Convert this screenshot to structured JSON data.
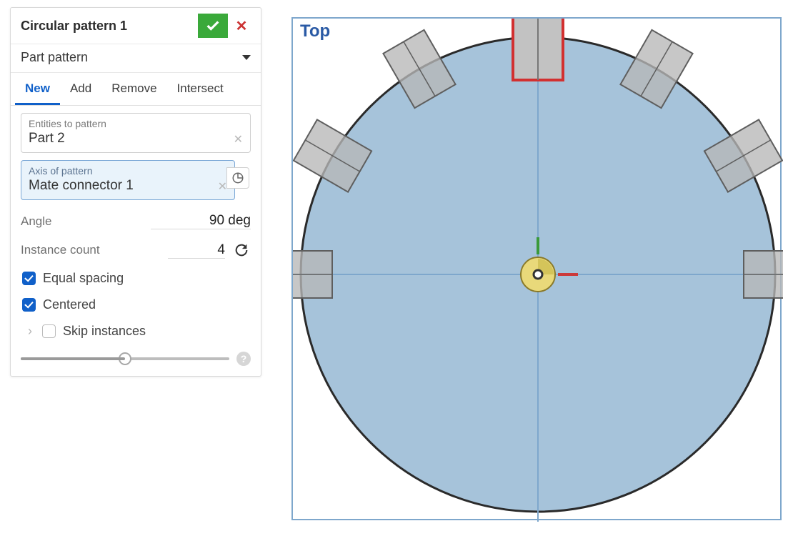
{
  "panel": {
    "title": "Circular pattern 1",
    "type_label": "Part pattern",
    "tabs": [
      "New",
      "Add",
      "Remove",
      "Intersect"
    ],
    "active_tab": 0,
    "entities_field": {
      "label": "Entities to pattern",
      "value": "Part 2"
    },
    "axis_field": {
      "label": "Axis of pattern",
      "value": "Mate connector 1"
    },
    "angle": {
      "label": "Angle",
      "value": "90 deg"
    },
    "count": {
      "label": "Instance count",
      "value": "4"
    },
    "equal_spacing_label": "Equal spacing",
    "centered_label": "Centered",
    "skip_label": "Skip instances",
    "equal_spacing_checked": true,
    "centered_checked": true,
    "skip_checked": false
  },
  "viewport": {
    "orientation_label": "Top"
  }
}
